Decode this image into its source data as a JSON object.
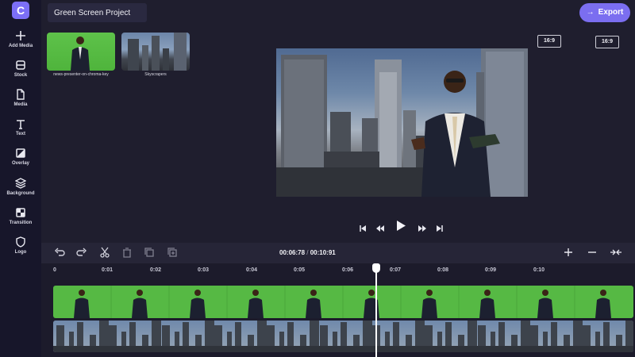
{
  "app": {
    "logo_letter": "C",
    "brand_color": "#7c6ff7"
  },
  "project": {
    "title": "Green Screen Project"
  },
  "export": {
    "label": "Export",
    "arrow": "→"
  },
  "sidebar": {
    "items": [
      {
        "label": "Add Media",
        "icon": "plus-icon"
      },
      {
        "label": "Stock",
        "icon": "stock-icon"
      },
      {
        "label": "Media",
        "icon": "file-icon"
      },
      {
        "label": "Text",
        "icon": "text-icon"
      },
      {
        "label": "Overlay",
        "icon": "overlay-icon"
      },
      {
        "label": "Background",
        "icon": "layers-icon"
      },
      {
        "label": "Transition",
        "icon": "transition-icon"
      },
      {
        "label": "Logo",
        "icon": "shield-icon"
      }
    ]
  },
  "media": {
    "items": [
      {
        "label": "news-presenter-on-chroma-key"
      },
      {
        "label": "Skyscrapers"
      }
    ]
  },
  "aspect": {
    "left": "16:9",
    "right": "16:9"
  },
  "timeline": {
    "current_time": "00:06:78",
    "separator": " / ",
    "total_time": "00:10:91",
    "ruler": [
      "0",
      "0:01",
      "0:02",
      "0:03",
      "0:04",
      "0:05",
      "0:06",
      "0:07",
      "0:08",
      "0:09",
      "0:10"
    ],
    "green_clip_frames": 10,
    "city_clip_frames": 11
  },
  "colors": {
    "sidebar_bg": "#17162a",
    "main_bg": "#1f1e2e",
    "accent": "#7b6ef0",
    "chroma_green": "#56b944"
  }
}
